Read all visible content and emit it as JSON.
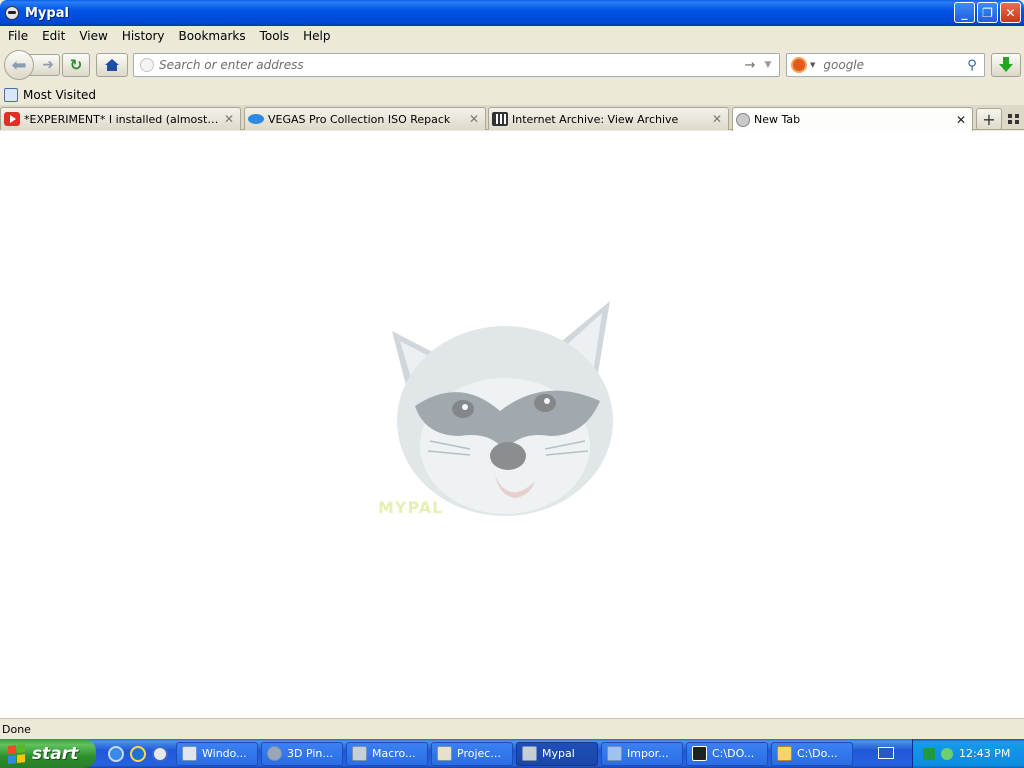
{
  "window": {
    "title": "Mypal"
  },
  "menu": [
    "File",
    "Edit",
    "View",
    "History",
    "Bookmarks",
    "Tools",
    "Help"
  ],
  "navigation": {
    "address_placeholder": "Search or enter address",
    "search_placeholder": "google"
  },
  "bookmarks": {
    "most_visited": "Most Visited"
  },
  "tabs": [
    {
      "label": "*EXPERIMENT* I installed (almost) all v...",
      "icon": "youtube-icon",
      "active": false
    },
    {
      "label": "VEGAS Pro Collection ISO Repack",
      "icon": "vegas-icon",
      "active": false
    },
    {
      "label": "Internet Archive: View Archive",
      "icon": "archive-icon",
      "active": false
    },
    {
      "label": "New Tab",
      "icon": "globe-icon",
      "active": true
    }
  ],
  "content": {
    "mascot": "raccoon-logo",
    "logo_text": "MYPAL"
  },
  "status": {
    "text": "Done"
  },
  "taskbar": {
    "start_label": "start",
    "items": [
      {
        "label": "Windo...",
        "icon": "window-icon",
        "active": false
      },
      {
        "label": "3D Pin...",
        "icon": "pinball-icon",
        "active": false
      },
      {
        "label": "Macro...",
        "icon": "raccoon-icon",
        "active": false
      },
      {
        "label": "Projec...",
        "icon": "project-icon",
        "active": false
      },
      {
        "label": "Mypal",
        "icon": "raccoon-icon",
        "active": true
      },
      {
        "label": "Impor...",
        "icon": "document-icon",
        "active": false
      },
      {
        "label": "C:\\DO...",
        "icon": "7zip-icon",
        "active": false
      },
      {
        "label": "C:\\Do...",
        "icon": "folder-icon",
        "active": false
      }
    ],
    "clock": "12:43 PM"
  },
  "colors": {
    "titlebar": "#0054e3",
    "taskbar": "#245edb",
    "start": "#3c9a3c",
    "chrome": "#ece9d8"
  }
}
